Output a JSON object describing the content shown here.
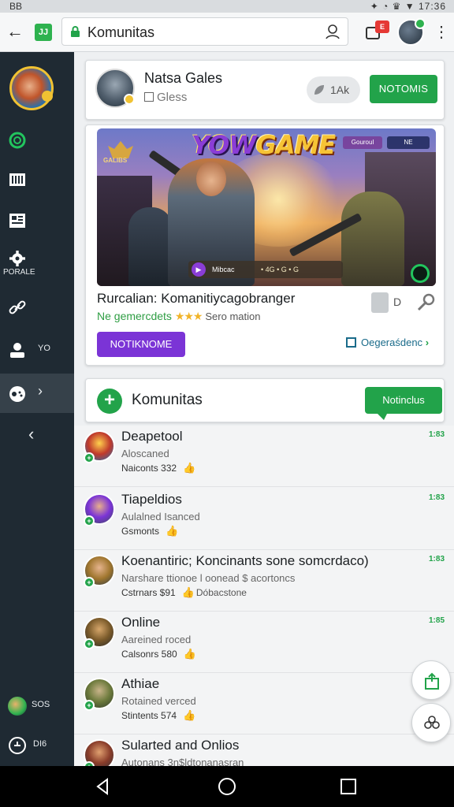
{
  "status": {
    "left": "BB",
    "time": "17:36"
  },
  "browser": {
    "url": "Komunitas",
    "site_badge": "JJ",
    "tab_badge": "E"
  },
  "sidebar": {
    "settings_label": "PORALE",
    "items": [
      {
        "icon": "clock-icon",
        "label": ""
      },
      {
        "icon": "grid-icon",
        "label": ""
      },
      {
        "icon": "news-icon",
        "label": ""
      },
      {
        "icon": "gear-icon",
        "label": ""
      },
      {
        "icon": "link-icon",
        "label": ""
      },
      {
        "icon": "person-icon",
        "label": "YO"
      },
      {
        "icon": "controller-icon",
        "label": ""
      }
    ],
    "bottom": [
      {
        "icon": "avatar-icon",
        "label": "SOS"
      },
      {
        "icon": "power-icon",
        "label": "DI6"
      }
    ]
  },
  "profile_card": {
    "name": "Natsa Gales",
    "sub": "Gless",
    "likes": "1Ak",
    "follow_label": "NOTOMIS"
  },
  "game_card": {
    "banner": {
      "title_part1": "YOW",
      "title_part2": "GAME",
      "emblem_label": "GALIBS",
      "chip1": "Gouroul",
      "chip2": "NE",
      "strip_text": "Mibcac",
      "strip_dots": "• 4G • G • G"
    },
    "title": "Rurcalian: Komanitiycagobranger",
    "meta_left": "Ne gemercdets",
    "stars": "★★★",
    "meta_right": "Sero mation",
    "side_letter": "D",
    "join_label": "NOTIKNOME",
    "link_label": "Oegeraśdenc"
  },
  "community": {
    "title": "Komunitas",
    "button_label": "Notinclus"
  },
  "feed": [
    {
      "name": "Deapetool",
      "sub": "Aloscaned",
      "count": "Naiconts 332",
      "tag": "",
      "time": "1:83",
      "avatar": [
        "#ffd14d",
        "#c0392b",
        "#1e6fb4"
      ]
    },
    {
      "name": "Tiapeldios",
      "sub": "Aulalned Isanced",
      "count": "Gsmonts",
      "tag": "",
      "time": "1:83",
      "avatar": [
        "#e8b08a",
        "#7b34d6",
        "#3a4a5a"
      ]
    },
    {
      "name": "Koenantiric; Koncinants sone somcrdaco)",
      "sub": "Narshare ttionoe l oonead $ acortoncs",
      "count": "Cstrnars $91",
      "tag": "Dóbacstone",
      "time": "1:83",
      "avatar": [
        "#e6b48e",
        "#a0762e",
        "#2d3a44"
      ]
    },
    {
      "name": "Online",
      "sub": "Aareined roced",
      "count": "Calsonrs 580",
      "tag": "",
      "time": "1:85",
      "avatar": [
        "#d6a66a",
        "#7a5a2a",
        "#2a2a2a"
      ]
    },
    {
      "name": "Athiae",
      "sub": "Rotained verced",
      "count": "Stintents 574",
      "tag": "",
      "time": "",
      "avatar": [
        "#c9b48a",
        "#6c7a3c",
        "#2f3a2a"
      ]
    },
    {
      "name": "Sularted and Onlios",
      "sub": "Autonans 3n$ldtonanasran",
      "count": "",
      "tag": "",
      "time": "",
      "avatar": [
        "#e0a070",
        "#8a3d2a",
        "#2a2f36"
      ]
    }
  ],
  "colors": {
    "accent_green": "#22a34a",
    "accent_purple": "#7b34d6",
    "sidebar_bg": "#1f2a33"
  }
}
